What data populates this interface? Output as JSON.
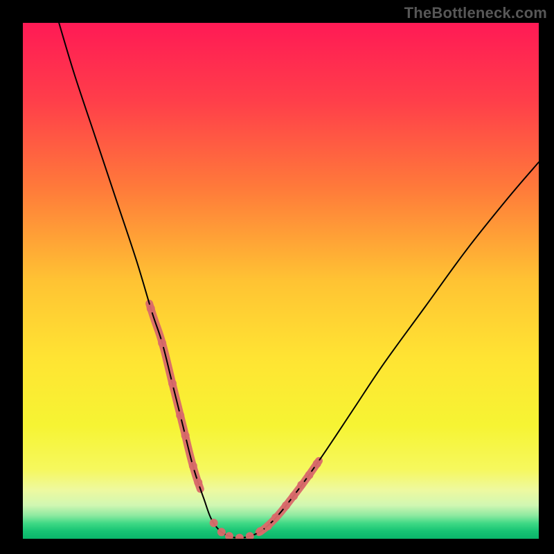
{
  "watermark": "TheBottleneck.com",
  "colors": {
    "frame": "#000000",
    "watermark": "#575757",
    "curve": "#000000",
    "highlight_red": "#d96a6a",
    "gradient_stops": [
      {
        "offset": 0.0,
        "color": "#ff1a55"
      },
      {
        "offset": 0.15,
        "color": "#ff3e4a"
      },
      {
        "offset": 0.32,
        "color": "#ff7a3a"
      },
      {
        "offset": 0.5,
        "color": "#ffc333"
      },
      {
        "offset": 0.65,
        "color": "#ffe433"
      },
      {
        "offset": 0.78,
        "color": "#f6f433"
      },
      {
        "offset": 0.865,
        "color": "#f6f85d"
      },
      {
        "offset": 0.905,
        "color": "#eef99f"
      },
      {
        "offset": 0.935,
        "color": "#d1f7b2"
      },
      {
        "offset": 0.955,
        "color": "#8de9a0"
      },
      {
        "offset": 0.97,
        "color": "#3fd985"
      },
      {
        "offset": 0.985,
        "color": "#17c374"
      },
      {
        "offset": 1.0,
        "color": "#0ab56a"
      }
    ]
  },
  "chart_data": {
    "type": "line",
    "title": "",
    "xlabel": "",
    "ylabel": "",
    "xlim": [
      0,
      100
    ],
    "ylim": [
      0,
      100
    ],
    "series": [
      {
        "name": "bottleneck-curve",
        "x": [
          7,
          10,
          14,
          18,
          22,
          25,
          27,
          29,
          31,
          33,
          35,
          37,
          40,
          44,
          48,
          53,
          58,
          64,
          70,
          78,
          86,
          94,
          100
        ],
        "y": [
          100,
          90,
          78,
          66,
          54,
          44,
          38,
          30,
          22,
          14,
          8,
          3,
          0.5,
          0.5,
          3,
          9,
          16,
          25,
          34,
          45,
          56,
          66,
          73
        ]
      }
    ],
    "highlighted_segments": [
      {
        "name": "left-descent",
        "x_range": [
          24.5,
          34.5
        ]
      },
      {
        "name": "right-ascent",
        "x_range": [
          45.5,
          57.5
        ]
      }
    ],
    "highlighted_dots_x": [
      24.8,
      27,
      29,
      30.5,
      31.5,
      33,
      34,
      37,
      38.5,
      40,
      42,
      44,
      46,
      47.5,
      49,
      51,
      52.5,
      54,
      55.5,
      57
    ]
  }
}
